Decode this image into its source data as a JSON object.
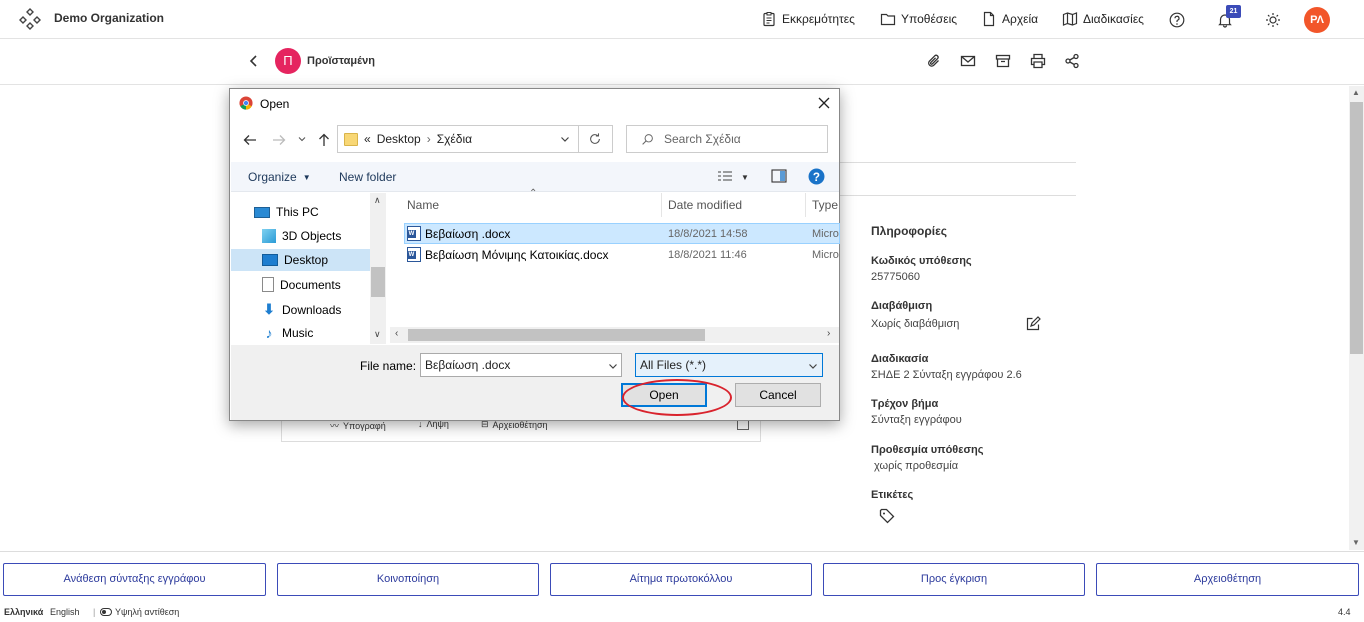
{
  "app": {
    "org_name": "Demo Organization",
    "nav": [
      "Εκκρεμότητες",
      "Υποθέσεις",
      "Αρχεία",
      "Διαδικασίες"
    ],
    "notifications_count": "21",
    "avatar_initials": "ΡΛ"
  },
  "case": {
    "owner_initial": "Π",
    "owner_name": "Προϊσταμένη",
    "card_actions": [
      "Υπογραφή",
      "Λήψη",
      "Αρχειοθέτηση"
    ]
  },
  "info": {
    "title": "Πληροφορίες",
    "fields": [
      {
        "label": "Κωδικός υπόθεσης",
        "value": "25775060"
      },
      {
        "label": "Διαβάθμιση",
        "value": "Χωρίς διαβάθμιση"
      },
      {
        "label": "Διαδικασία",
        "value": "ΣΗΔΕ 2 Σύνταξη εγγράφου 2.6"
      },
      {
        "label": "Τρέχον βήμα",
        "value": "Σύνταξη εγγράφου"
      },
      {
        "label": "Προθεσμία υπόθεσης",
        "value": " χωρίς προθεσμία"
      },
      {
        "label": "Ετικέτες",
        "value": ""
      }
    ]
  },
  "actions": [
    "Ανάθεση σύνταξης εγγράφου",
    "Κοινοποίηση",
    "Αίτημα πρωτοκόλλου",
    "Προς έγκριση",
    "Αρχειοθέτηση"
  ],
  "footer": {
    "lang_el": "Ελληνικά",
    "lang_en": "English",
    "contrast": "Υψηλή αντίθεση",
    "version": "4.4"
  },
  "dialog": {
    "title": "Open",
    "path": [
      "Desktop",
      "Σχέδια"
    ],
    "path_prefix": "«",
    "search_placeholder": "Search Σχέδια",
    "organize": "Organize",
    "new_folder": "New folder",
    "tree": [
      "This PC",
      "3D Objects",
      "Desktop",
      "Documents",
      "Downloads",
      "Music"
    ],
    "columns": [
      "Name",
      "Date modified",
      "Type"
    ],
    "files": [
      {
        "name": "Βεβαίωση .docx",
        "date": "18/8/2021 14:58",
        "type": "Micro"
      },
      {
        "name": "Βεβαίωση Μόνιμης Κατοικίας.docx",
        "date": "18/8/2021 11:46",
        "type": "Micro"
      }
    ],
    "file_name_label": "File name:",
    "file_name_value": "Βεβαίωση .docx",
    "file_type": "All Files (*.*)",
    "open_label": "Open",
    "cancel_label": "Cancel"
  },
  "colors": {
    "accent": "#3b4bb8",
    "avatar": "#f2562a",
    "owner": "#e5245f",
    "highlight": "#d9232d"
  }
}
